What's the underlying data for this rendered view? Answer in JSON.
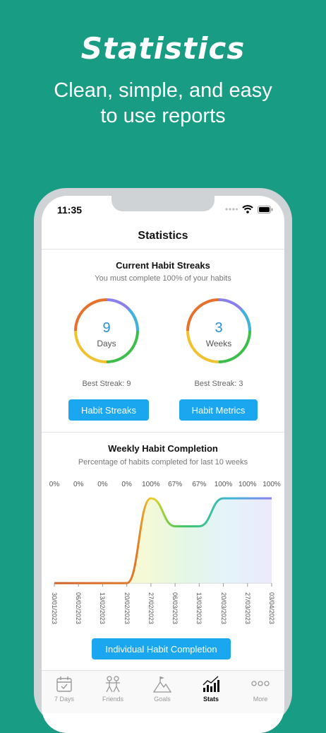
{
  "hero": {
    "title": "Statistics",
    "subtitle_line1": "Clean, simple, and easy",
    "subtitle_line2": "to use reports"
  },
  "status_bar": {
    "time": "11:35"
  },
  "nav": {
    "title": "Statistics"
  },
  "streaks": {
    "title": "Current Habit Streaks",
    "subtitle": "You must complete 100% of your habits",
    "days": {
      "value": "9",
      "unit": "Days",
      "best": "Best Streak: 9"
    },
    "weeks": {
      "value": "3",
      "unit": "Weeks",
      "best": "Best Streak: 3"
    },
    "button_streaks": "Habit Streaks",
    "button_metrics": "Habit Metrics"
  },
  "weekly": {
    "title": "Weekly Habit Completion",
    "subtitle": "Percentage of habits completed for last 10 weeks",
    "button": "Individual Habit Completion"
  },
  "chart_data": {
    "type": "area",
    "categories": [
      "30/01/2023",
      "06/02/2023",
      "13/02/2023",
      "20/02/2023",
      "27/02/2023",
      "06/03/2023",
      "13/03/2023",
      "20/03/2023",
      "27/03/2023",
      "03/04/2023"
    ],
    "value_labels": [
      "0%",
      "0%",
      "0%",
      "0%",
      "100%",
      "67%",
      "67%",
      "100%",
      "100%",
      "100%"
    ],
    "values": [
      0,
      0,
      0,
      0,
      100,
      67,
      67,
      100,
      100,
      100
    ],
    "ylim": [
      0,
      100
    ]
  },
  "tabs": [
    {
      "label": "7 Days",
      "icon": "calendar-check-icon"
    },
    {
      "label": "Friends",
      "icon": "friends-icon"
    },
    {
      "label": "Goals",
      "icon": "mountain-flag-icon"
    },
    {
      "label": "Stats",
      "icon": "stats-chart-icon",
      "active": true
    },
    {
      "label": "More",
      "icon": "more-dots-icon"
    }
  ]
}
